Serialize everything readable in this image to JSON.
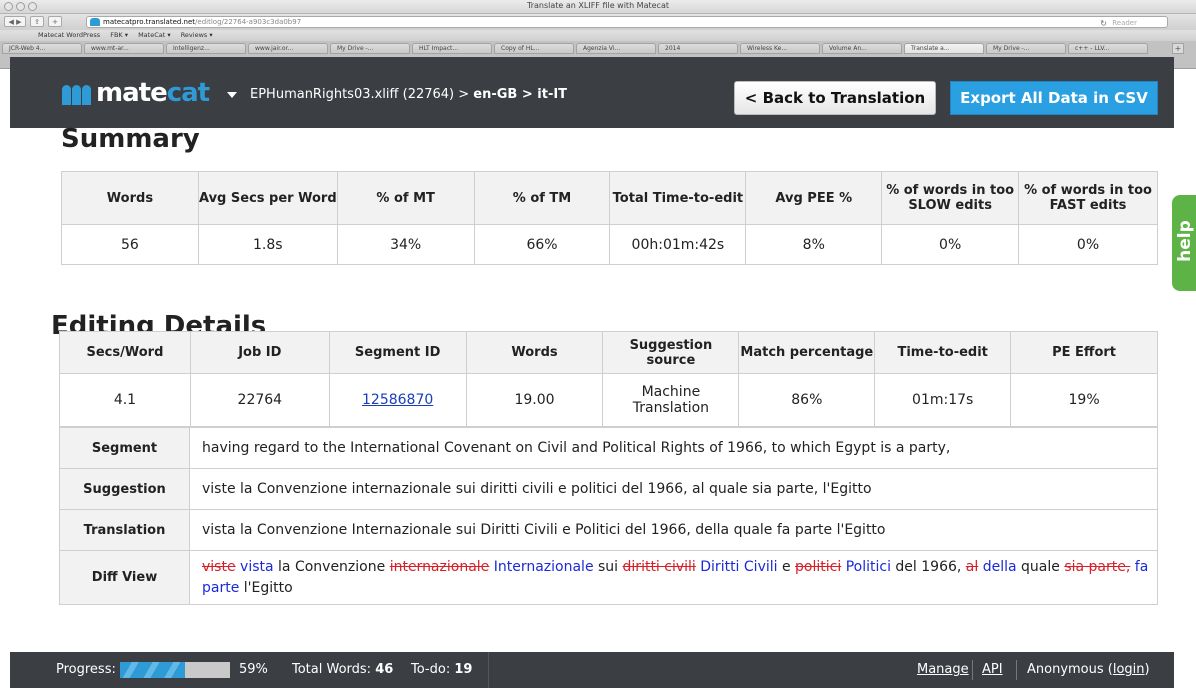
{
  "browser": {
    "window_title": "Translate an XLIFF file with Matecat",
    "url_host": "matecatpro.translated.net",
    "url_path": "/editlog/22764-a903c3da0b97",
    "reader_label": "Reader",
    "bookmarks": [
      "Matecat WordPress",
      "FBK ▾",
      "MateCat ▾",
      "Reviews ▾"
    ],
    "tabs": [
      "JCR-Web 4...",
      "www.mt-ar...",
      "Intelligenz...",
      "www.jair.or...",
      "My Drive -...",
      "HLT Impact...",
      "Copy of HL...",
      "Agenzia Vi...",
      "2014",
      "Wireless Ke...",
      "Volume An...",
      "Translate a...",
      "My Drive -...",
      "c++ - LLV..."
    ]
  },
  "header": {
    "logo_mate": "mate",
    "logo_cat": "cat",
    "breadcrumb_file": "EPHumanRights03.xliff (22764) > ",
    "breadcrumb_langs": "en-GB > it-IT",
    "back_button": "< Back to Translation",
    "export_button": "Export All Data in CSV"
  },
  "summary": {
    "title": "Summary",
    "headers": [
      "Words",
      "Avg Secs per Word",
      "% of MT",
      "% of TM",
      "Total Time-to-edit",
      "Avg PEE %",
      "% of words in too SLOW edits",
      "% of words in too FAST edits"
    ],
    "values": [
      "56",
      "1.8s",
      "34%",
      "66%",
      "00h:01m:42s",
      "8%",
      "0%",
      "0%"
    ]
  },
  "editing": {
    "title": "Editing Details",
    "headers": [
      "Secs/Word",
      "Job ID",
      "Segment ID",
      "Words",
      "Suggestion source",
      "Match percentage",
      "Time-to-edit",
      "PE Effort"
    ],
    "values": [
      "4.1",
      "22764",
      "12586870",
      "19.00",
      "Machine Translation",
      "86%",
      "01m:17s",
      "19%"
    ],
    "rows": {
      "segment_label": "Segment",
      "segment_text": "having regard to the International Covenant on Civil and Political Rights of 1966, to which Egypt is a party,",
      "suggestion_label": "Suggestion",
      "suggestion_text": "viste la Convenzione internazionale sui diritti civili e politici del 1966, al quale sia parte, l'Egitto",
      "translation_label": "Translation",
      "translation_text": "vista la Convenzione Internazionale sui Diritti Civili e Politici del 1966, della quale fa parte l'Egitto",
      "diff_label": "Diff View",
      "diff_tokens": [
        {
          "t": "viste",
          "k": "del"
        },
        {
          "t": " ",
          "k": "eq"
        },
        {
          "t": "vista",
          "k": "ins"
        },
        {
          "t": " la Convenzione ",
          "k": "eq"
        },
        {
          "t": "internazionale",
          "k": "del"
        },
        {
          "t": " ",
          "k": "eq"
        },
        {
          "t": "Internazionale",
          "k": "ins"
        },
        {
          "t": " sui ",
          "k": "eq"
        },
        {
          "t": "diritti civili",
          "k": "del"
        },
        {
          "t": " ",
          "k": "eq"
        },
        {
          "t": "Diritti Civili",
          "k": "ins"
        },
        {
          "t": " e ",
          "k": "eq"
        },
        {
          "t": "politici",
          "k": "del"
        },
        {
          "t": " ",
          "k": "eq"
        },
        {
          "t": "Politici",
          "k": "ins"
        },
        {
          "t": " del 1966, ",
          "k": "eq"
        },
        {
          "t": "al",
          "k": "del"
        },
        {
          "t": " ",
          "k": "eq"
        },
        {
          "t": "della",
          "k": "ins"
        },
        {
          "t": " quale ",
          "k": "eq"
        },
        {
          "t": "sia parte,",
          "k": "del"
        },
        {
          "t": " ",
          "k": "eq"
        },
        {
          "t": "fa parte",
          "k": "ins"
        },
        {
          "t": " l'Egitto",
          "k": "eq"
        }
      ]
    }
  },
  "help_label": "help",
  "footer": {
    "progress_label": "Progress:",
    "progress_fraction": 0.59,
    "progress_text": "59%",
    "total_words_label": "Total Words: ",
    "total_words_value": "46",
    "todo_label": "To-do: ",
    "todo_value": "19",
    "manage": "Manage",
    "api": "API",
    "user": "Anonymous (",
    "login": "login",
    "user_close": ")"
  },
  "colors": {
    "brand_blue": "#2f9bd6",
    "header_dark": "#3b3f44",
    "diff_deleted": "#d5202a",
    "diff_inserted": "#1a2ad8",
    "help_green": "#5db345"
  }
}
